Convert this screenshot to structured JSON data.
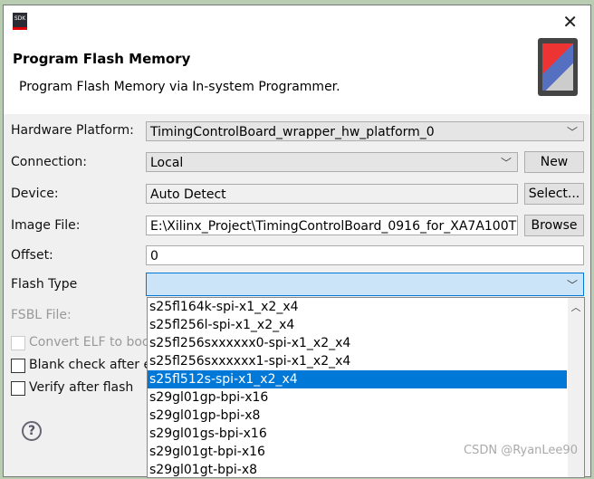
{
  "header": {
    "title": "Program Flash Memory",
    "subtitle": "Program Flash Memory via In-system Programmer.",
    "app_icon": "SDK"
  },
  "form": {
    "hardware_platform": {
      "label": "Hardware Platform:",
      "value": "TimingControlBoard_wrapper_hw_platform_0"
    },
    "connection": {
      "label": "Connection:",
      "value": "Local",
      "button": "New"
    },
    "device": {
      "label": "Device:",
      "value": "Auto Detect",
      "button": "Select..."
    },
    "image_file": {
      "label": "Image File:",
      "value": "E:\\Xilinx_Project\\TimingControlBoard_0916_for_XA7A100T",
      "button": "Browse"
    },
    "offset": {
      "label": "Offset:",
      "value": "0"
    },
    "flash_type": {
      "label": "Flash Type",
      "value": ""
    },
    "fsbl_file": {
      "label": "FSBL File:"
    },
    "convert_elf": {
      "label": "Convert ELF to bootloader",
      "checked": false,
      "disabled": true
    },
    "blank_check": {
      "label": "Blank check after erase",
      "checked": false
    },
    "verify": {
      "label": "Verify after flash",
      "checked": false
    }
  },
  "dropdown": {
    "selected_index": 4,
    "items": [
      "s25fl164k-spi-x1_x2_x4",
      "s25fl256l-spi-x1_x2_x4",
      "s25fl256sxxxxxx0-spi-x1_x2_x4",
      "s25fl256sxxxxxx1-spi-x1_x2_x4",
      "s25fl512s-spi-x1_x2_x4",
      "s29gl01gp-bpi-x16",
      "s29gl01gp-bpi-x8",
      "s29gl01gs-bpi-x16",
      "s29gl01gt-bpi-x16",
      "s29gl01gt-bpi-x8"
    ]
  },
  "watermark": "CSDN @RyanLee90",
  "colors": {
    "selection": "#0078d7",
    "flash_type_focus": "#cce4f7"
  }
}
